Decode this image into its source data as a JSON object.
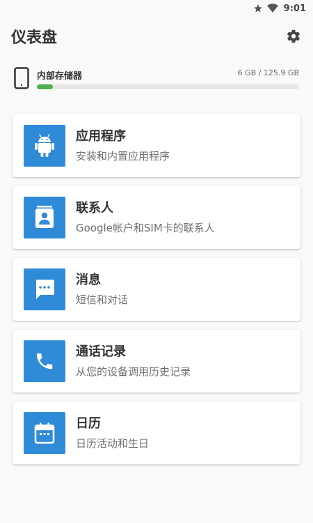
{
  "status": {
    "time": "9:01"
  },
  "header": {
    "title": "仪表盘"
  },
  "storage": {
    "label": "内部存储器",
    "size": "6 GB / 125.9 GB",
    "used_fraction": 0.06,
    "color": "#4caf50"
  },
  "accent": "#2f8ad8",
  "items": [
    {
      "icon": "android-icon",
      "title": "应用程序",
      "subtitle": "安装和内置应用程序"
    },
    {
      "icon": "contact-card-icon",
      "title": "联系人",
      "subtitle": "Google帐户和SIM卡的联系人"
    },
    {
      "icon": "message-icon",
      "title": "消息",
      "subtitle": "短信和对话"
    },
    {
      "icon": "phone-icon",
      "title": "通话记录",
      "subtitle": "从您的设备调用历史记录"
    },
    {
      "icon": "calendar-icon",
      "title": "日历",
      "subtitle": "日历活动和生日"
    }
  ]
}
